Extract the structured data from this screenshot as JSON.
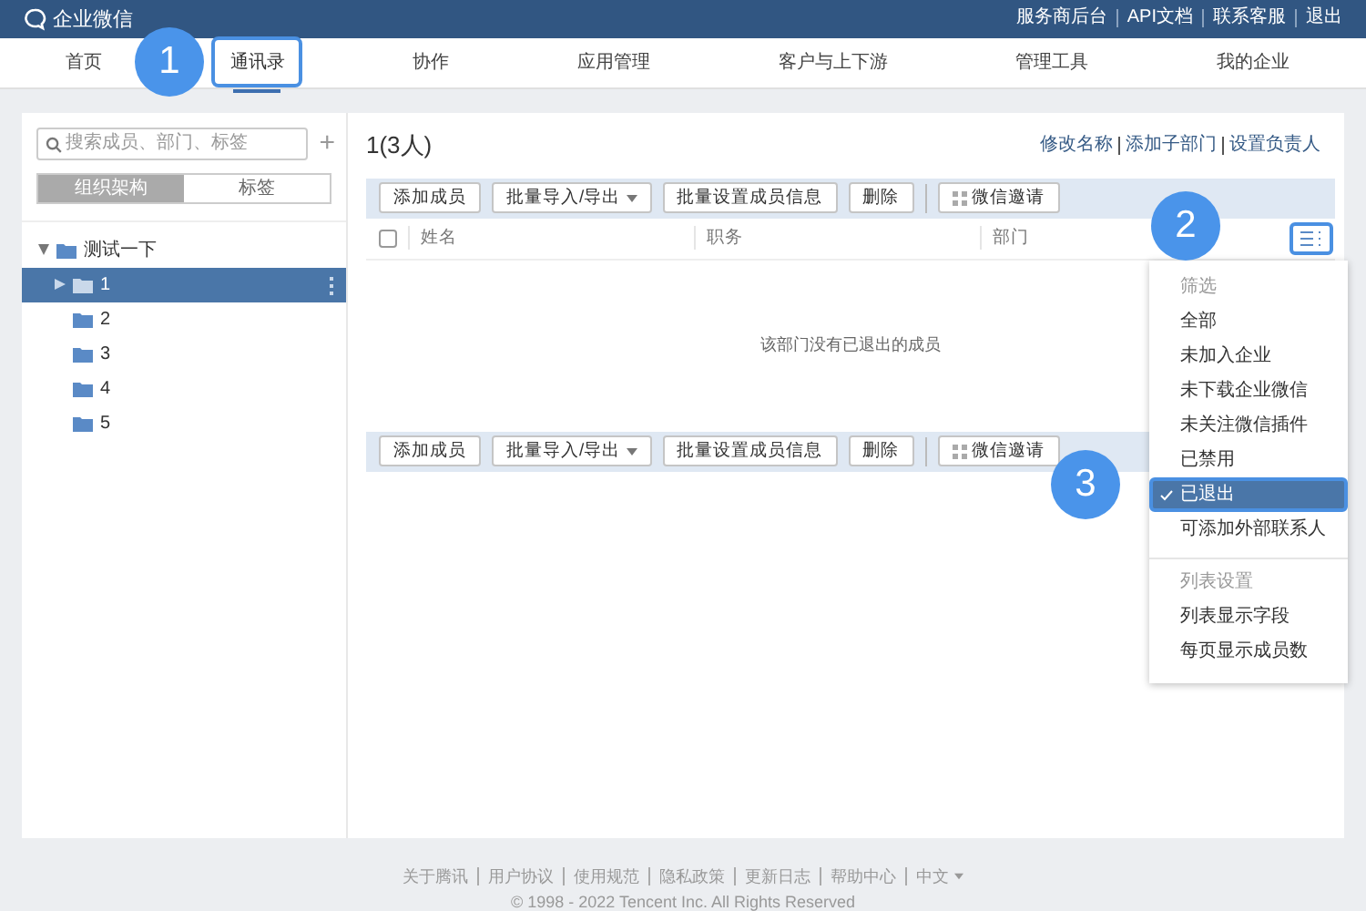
{
  "header": {
    "logo": "企业微信",
    "links": [
      "服务商后台",
      "API文档",
      "联系客服",
      "退出"
    ]
  },
  "nav": [
    {
      "label": "首页",
      "selected": false
    },
    {
      "label": "通讯录",
      "selected": true
    },
    {
      "label": "协作",
      "selected": false
    },
    {
      "label": "应用管理",
      "selected": false
    },
    {
      "label": "客户与上下游",
      "selected": false
    },
    {
      "label": "管理工具",
      "selected": false
    },
    {
      "label": "我的企业",
      "selected": false
    }
  ],
  "sidebar": {
    "search": {
      "placeholder": "搜索成员、部门、标签"
    },
    "add": "+",
    "tabs": [
      {
        "label": "组织架构",
        "selected": true
      },
      {
        "label": "标签",
        "selected": false
      }
    ],
    "tree": [
      {
        "label": "测试一下",
        "expanded": true,
        "selected": false,
        "children": [
          {
            "label": "1",
            "expanded": false,
            "selected": true
          },
          {
            "label": "2",
            "selected": false
          },
          {
            "label": "3",
            "selected": false
          },
          {
            "label": "4",
            "selected": false
          },
          {
            "label": "5",
            "selected": false
          }
        ]
      }
    ]
  },
  "main": {
    "title": "1(3人)",
    "links": [
      "修改名称",
      "添加子部门",
      "设置负责人"
    ],
    "toolbar": [
      {
        "label": "添加成员",
        "kind": "plain"
      },
      {
        "label": "批量导入/导出",
        "kind": "dropdown"
      },
      {
        "label": "批量设置成员信息",
        "kind": "plain"
      },
      {
        "label": "删除",
        "kind": "plain"
      },
      {
        "label": "微信邀请",
        "kind": "qr"
      }
    ],
    "toolbar_bottom": [
      {
        "label": "添加成员",
        "kind": "plain"
      },
      {
        "label": "批量导入/导出",
        "kind": "dropdown"
      },
      {
        "label": "批量设置成员信息",
        "kind": "plain"
      },
      {
        "label": "删除",
        "kind": "plain"
      },
      {
        "label": "微信邀请",
        "kind": "qr"
      }
    ],
    "select_all": {
      "checked": false
    },
    "columns": [
      "姓名",
      "职务",
      "部门"
    ],
    "empty_message": "该部门没有已退出的成员"
  },
  "menu": {
    "sections": [
      {
        "title": "筛选",
        "items": [
          {
            "label": "全部",
            "selected": false
          },
          {
            "label": "未加入企业",
            "selected": false
          },
          {
            "label": "未下载企业微信",
            "selected": false
          },
          {
            "label": "未关注微信插件",
            "selected": false
          },
          {
            "label": "已禁用",
            "selected": false
          },
          {
            "label": "已退出",
            "selected": true
          },
          {
            "label": "可添加外部联系人",
            "selected": false
          }
        ]
      },
      {
        "title": "列表设置",
        "items": [
          {
            "label": "列表显示字段",
            "selected": false
          },
          {
            "label": "每页显示成员数",
            "selected": false
          }
        ]
      }
    ]
  },
  "callouts": [
    "1",
    "2",
    "3"
  ],
  "footer": {
    "links": [
      "关于腾讯",
      "用户协议",
      "使用规范",
      "隐私政策",
      "更新日志",
      "帮助中心",
      "中文"
    ],
    "copyright": "© 1998 - 2022 Tencent Inc. All Rights Reserved"
  }
}
